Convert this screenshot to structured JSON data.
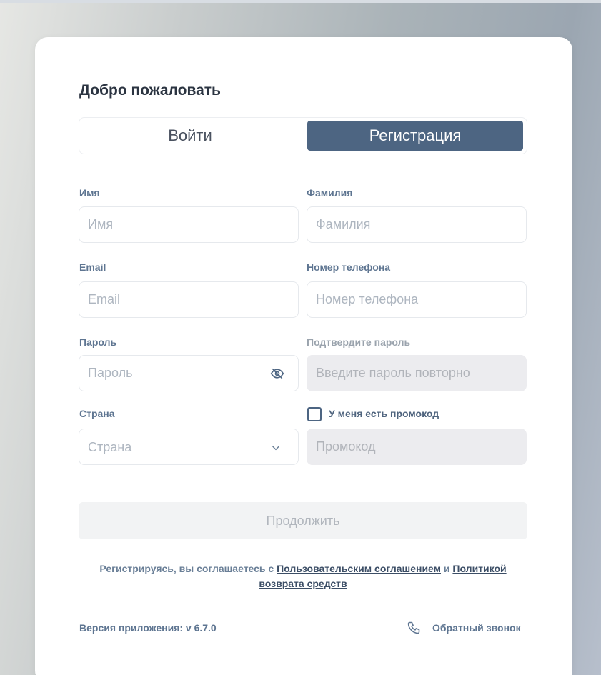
{
  "title": "Добро пожаловать",
  "tabs": {
    "login": "Войти",
    "register": "Регистрация",
    "active": "register"
  },
  "form": {
    "first_name": {
      "label": "Имя",
      "placeholder": "Имя",
      "value": ""
    },
    "last_name": {
      "label": "Фамилия",
      "placeholder": "Фамилия",
      "value": ""
    },
    "email": {
      "label": "Email",
      "placeholder": "Email",
      "value": ""
    },
    "phone": {
      "label": "Номер телефона",
      "placeholder": "Номер телефона",
      "value": ""
    },
    "password": {
      "label": "Пароль",
      "placeholder": "Пароль",
      "value": "",
      "toggle_icon": "eye-off-icon"
    },
    "confirm_password": {
      "label": "Подтвердите пароль",
      "placeholder": "Введите пароль повторно",
      "value": "",
      "disabled": true
    },
    "country": {
      "label": "Страна",
      "placeholder": "Страна",
      "icon": "chevron-down-icon"
    },
    "promo_checkbox": {
      "label": "У меня есть промокод",
      "checked": false
    },
    "promo": {
      "placeholder": "Промокод",
      "value": "",
      "disabled": true
    }
  },
  "continue_label": "Продолжить",
  "agreement": {
    "prefix": "Регистрируясь, вы соглашаетесь с",
    "terms_link": "Пользовательским соглашением",
    "conjunction": "и",
    "refund_link_part1": "Политикой",
    "refund_link_part2": "возврата средств"
  },
  "footer": {
    "version": "Версия приложения: v 6.7.0",
    "callback": "Обратный звонок",
    "callback_icon": "phone-icon"
  },
  "colors": {
    "accent": "#4d6582",
    "label": "#5e7591",
    "title": "#2b3441",
    "disabled_bg": "#ececef"
  }
}
